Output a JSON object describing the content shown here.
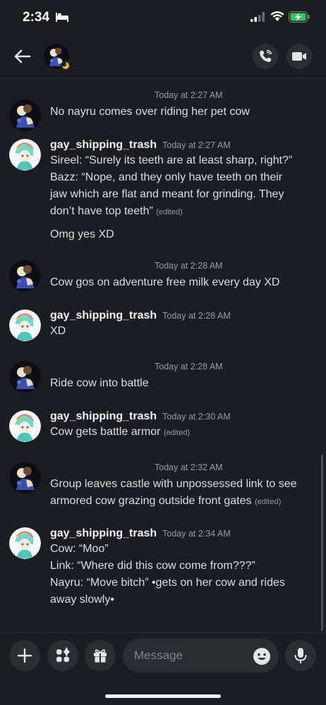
{
  "status_bar": {
    "time": "2:34"
  },
  "composer": {
    "placeholder": "Message"
  },
  "messages": [
    {
      "timestamp": "Today at 2:27 AM",
      "text": "No nayru comes over riding her pet cow"
    },
    {
      "username": "gay_shipping_trash",
      "timestamp": "Today at 2:27 AM",
      "line1": "Sireel: “Surely its teeth are at least sharp, right?”",
      "line2": "Bazz: “Nope, and they only have teeth on their",
      "line3": "jaw which are flat and meant for grinding. They",
      "line4": "don’t have top teeth”",
      "edited": "(edited)",
      "line5": "Omg yes XD"
    },
    {
      "timestamp": "Today at 2:28 AM",
      "text": "Cow gos on adventure free milk every day XD"
    },
    {
      "username": "gay_shipping_trash",
      "timestamp": "Today at 2:28 AM",
      "text": "XD"
    },
    {
      "timestamp": "Today at 2:28 AM",
      "text": "Ride cow into battle"
    },
    {
      "username": "gay_shipping_trash",
      "timestamp": "Today at 2:30 AM",
      "text": "Cow gets battle armor",
      "edited": "(edited)"
    },
    {
      "timestamp": "Today at 2:32 AM",
      "line1": "Group leaves castle with unpossessed link to see",
      "line2": "armored cow grazing outside front gates",
      "edited": "(edited)"
    },
    {
      "username": "gay_shipping_trash",
      "timestamp": "Today at 2:34 AM",
      "line1": "Cow: “Moo”",
      "line2": "Link: “Where did this cow come from???”",
      "line3": "Nayru: “Move bitch” •gets on her cow and rides",
      "line4": "away slowly•"
    }
  ]
}
